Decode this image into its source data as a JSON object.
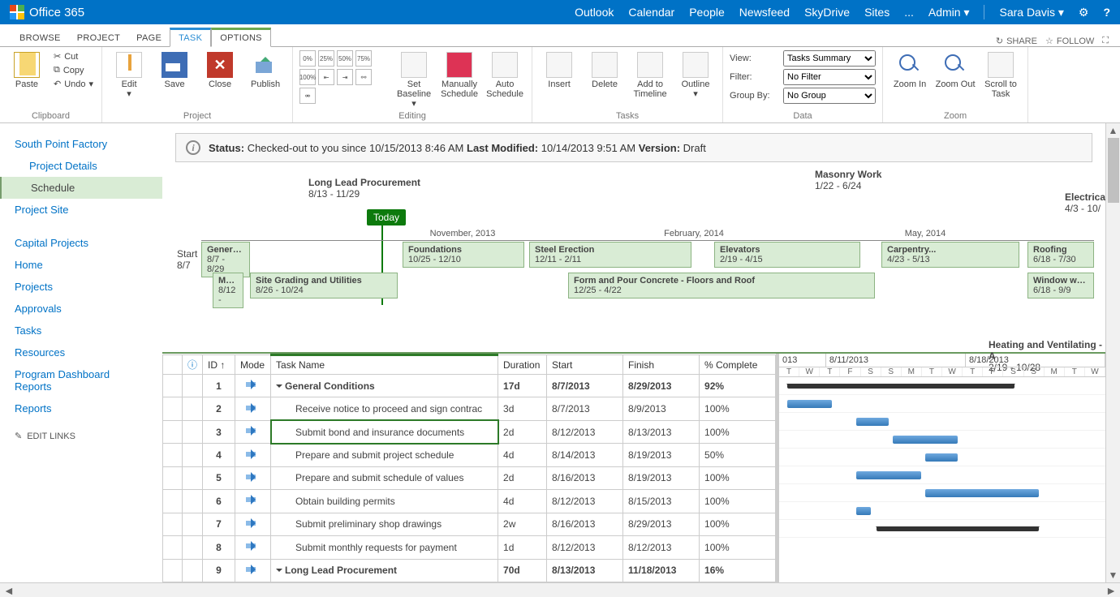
{
  "topbar": {
    "brand": "Office 365",
    "links": [
      "Outlook",
      "Calendar",
      "People",
      "Newsfeed",
      "SkyDrive",
      "Sites"
    ],
    "more": "...",
    "admin": "Admin",
    "user": "Sara Davis"
  },
  "ribbon_tabs": [
    "BROWSE",
    "PROJECT",
    "PAGE",
    "TASK",
    "OPTIONS"
  ],
  "ribbon_active": "TASK",
  "ribbon_actions": {
    "share": "SHARE",
    "follow": "FOLLOW"
  },
  "ribbon": {
    "clipboard": {
      "paste": "Paste",
      "cut": "Cut",
      "copy": "Copy",
      "undo": "Undo",
      "group": "Clipboard"
    },
    "project": {
      "edit": "Edit",
      "save": "Save",
      "close": "Close",
      "publish": "Publish",
      "group": "Project"
    },
    "editing": {
      "pct": [
        "0%",
        "25%",
        "50%",
        "75%",
        "100%"
      ],
      "baseline": "Set Baseline",
      "manual": "Manually Schedule",
      "auto": "Auto Schedule",
      "group": "Editing"
    },
    "tasks": {
      "insert": "Insert",
      "delete": "Delete",
      "add": "Add to Timeline",
      "outline": "Outline",
      "group": "Tasks"
    },
    "data": {
      "view": "View:",
      "filter": "Filter:",
      "groupby": "Group By:",
      "view_sel": "Tasks Summary",
      "filter_sel": "No Filter",
      "group_sel": "No Group",
      "group": "Data"
    },
    "zoom": {
      "zoomin": "Zoom In",
      "zoomout": "Zoom Out",
      "scroll": "Scroll to Task",
      "group": "Zoom"
    }
  },
  "leftnav": {
    "items1": [
      "South Point Factory",
      "Project Details",
      "Schedule",
      "Project Site"
    ],
    "items2": [
      "Capital Projects",
      "Home",
      "Projects",
      "Approvals",
      "Tasks",
      "Resources",
      "Program Dashboard Reports",
      "Reports"
    ],
    "edit_links": "EDIT LINKS"
  },
  "status": {
    "label": "Status:",
    "text": "Checked-out to you since 10/15/2013 8:46 AM",
    "lm_label": "Last Modified:",
    "lm_text": "10/14/2013 9:51 AM",
    "ver_label": "Version:",
    "ver_text": "Draft"
  },
  "timeline": {
    "start_label": "Start",
    "start_date": "8/7",
    "today": "Today",
    "months": [
      "November, 2013",
      "February, 2014",
      "May, 2014"
    ],
    "annot": [
      {
        "title": "Long Lead Procurement",
        "dates": "8/13 - 11/29"
      },
      {
        "title": "Masonry Work",
        "dates": "1/22 - 6/24"
      },
      {
        "title": "Electrical",
        "dates": "4/3 - 10/"
      },
      {
        "title": "Heating and Ventilating - A",
        "dates": "2/19 - 10/28"
      }
    ],
    "row1": [
      {
        "title": "General Co...",
        "dates": "8/7 - 8/29"
      },
      {
        "title": "Foundations",
        "dates": "10/25 - 12/10"
      },
      {
        "title": "Steel Erection",
        "dates": "12/11 - 2/11"
      },
      {
        "title": "Elevators",
        "dates": "2/19 - 4/15"
      },
      {
        "title": "Carpentry...",
        "dates": "4/23 - 5/13"
      },
      {
        "title": "Roofing",
        "dates": "6/18 - 7/30"
      }
    ],
    "row2": [
      {
        "title": "Mo...",
        "dates": "8/12 -"
      },
      {
        "title": "Site Grading and Utilities",
        "dates": "8/26 - 10/24"
      },
      {
        "title": "Form and Pour Concrete - Floors and Roof",
        "dates": "12/25 - 4/22"
      },
      {
        "title": "Window wall an",
        "dates": "6/18 - 9/9"
      }
    ]
  },
  "grid": {
    "headers": [
      "",
      "ID ↑",
      "Mode",
      "Task Name",
      "Duration",
      "Start",
      "Finish",
      "% Complete"
    ],
    "rows": [
      {
        "id": "1",
        "name": "General Conditions",
        "dur": "17d",
        "start": "8/7/2013",
        "finish": "8/29/2013",
        "pct": "92%",
        "summary": true
      },
      {
        "id": "2",
        "name": "Receive notice to proceed and sign contrac",
        "dur": "3d",
        "start": "8/7/2013",
        "finish": "8/9/2013",
        "pct": "100%"
      },
      {
        "id": "3",
        "name": "Submit bond and insurance documents",
        "dur": "2d",
        "start": "8/12/2013",
        "finish": "8/13/2013",
        "pct": "100%",
        "selected": true
      },
      {
        "id": "4",
        "name": "Prepare and submit project schedule",
        "dur": "4d",
        "start": "8/14/2013",
        "finish": "8/19/2013",
        "pct": "50%"
      },
      {
        "id": "5",
        "name": "Prepare and submit schedule of values",
        "dur": "2d",
        "start": "8/16/2013",
        "finish": "8/19/2013",
        "pct": "100%"
      },
      {
        "id": "6",
        "name": "Obtain building permits",
        "dur": "4d",
        "start": "8/12/2013",
        "finish": "8/15/2013",
        "pct": "100%"
      },
      {
        "id": "7",
        "name": "Submit preliminary shop drawings",
        "dur": "2w",
        "start": "8/16/2013",
        "finish": "8/29/2013",
        "pct": "100%"
      },
      {
        "id": "8",
        "name": "Submit monthly requests for payment",
        "dur": "1d",
        "start": "8/12/2013",
        "finish": "8/12/2013",
        "pct": "100%"
      },
      {
        "id": "9",
        "name": "Long Lead Procurement",
        "dur": "70d",
        "start": "8/13/2013",
        "finish": "11/18/2013",
        "pct": "16%",
        "summary": true
      }
    ]
  },
  "gantt": {
    "weeks": [
      "013",
      "8/11/2013",
      "8/18/2013"
    ],
    "days": [
      "T",
      "W",
      "T",
      "F",
      "S",
      "S",
      "M",
      "T",
      "W",
      "T",
      "F",
      "S",
      "S",
      "M",
      "T",
      "W"
    ]
  }
}
